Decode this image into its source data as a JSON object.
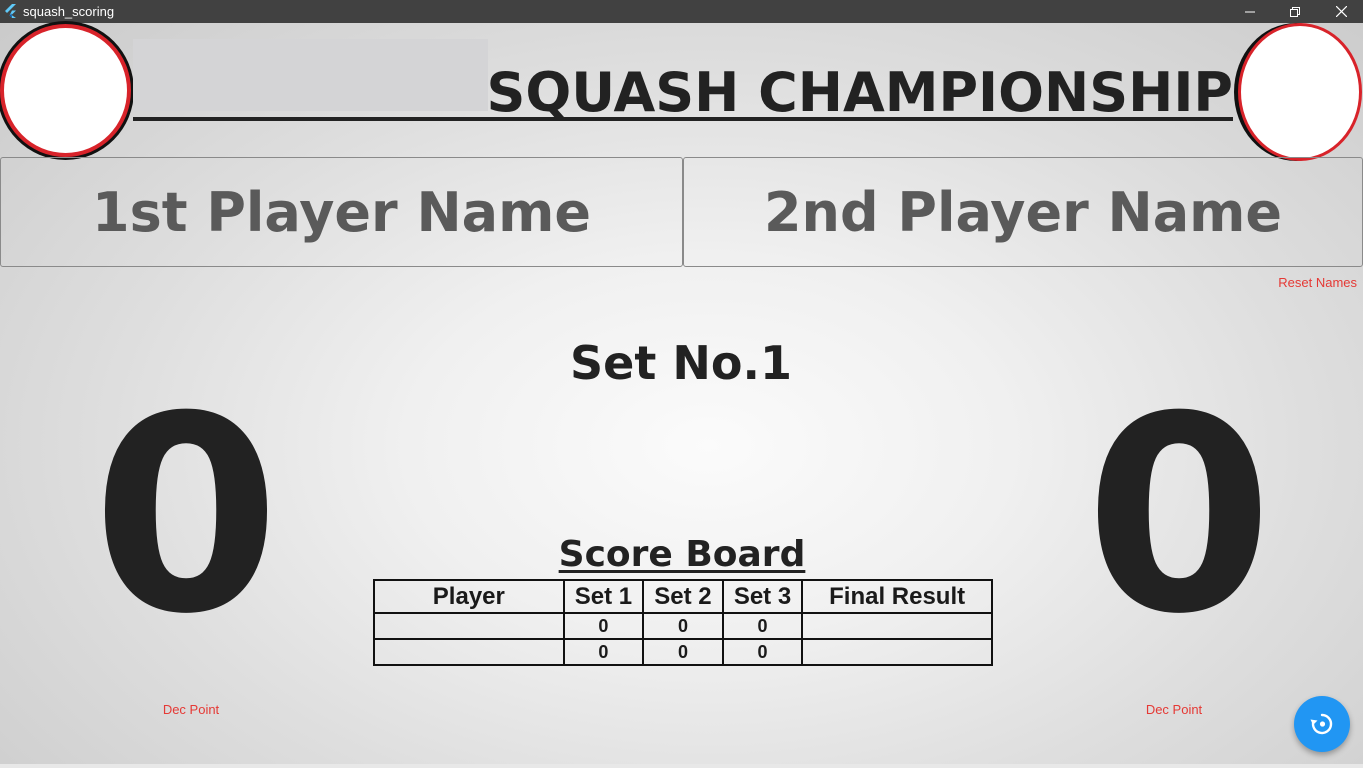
{
  "window": {
    "title": "squash_scoring",
    "app_icon": "flutter-icon",
    "controls": [
      "minimize-icon",
      "restore-icon",
      "close-icon"
    ]
  },
  "header": {
    "title": "SQUASH CHAMPIONSHIP",
    "left_logo": "logo",
    "right_logo": "logo"
  },
  "players": {
    "player1_name": "1st Player Name",
    "player2_name": "2nd Player Name",
    "reset_label": "Reset Names"
  },
  "match": {
    "set_label": "Set No.1",
    "player1_score": "0",
    "player2_score": "0",
    "dec_point_label_1": "Dec Point",
    "dec_point_label_2": "Dec Point"
  },
  "scoreboard": {
    "title": "Score Board",
    "headers": [
      "Player",
      "Set 1",
      "Set 2",
      "Set 3",
      "Final Result"
    ],
    "rows": [
      [
        "",
        "0",
        "0",
        "0",
        ""
      ],
      [
        "",
        "0",
        "0",
        "0",
        ""
      ]
    ]
  },
  "fab": {
    "icon": "restart-icon",
    "color": "#2196f3"
  },
  "colors": {
    "accent_red": "#e53935",
    "text_dark": "#222222",
    "titlebar": "#414141"
  }
}
